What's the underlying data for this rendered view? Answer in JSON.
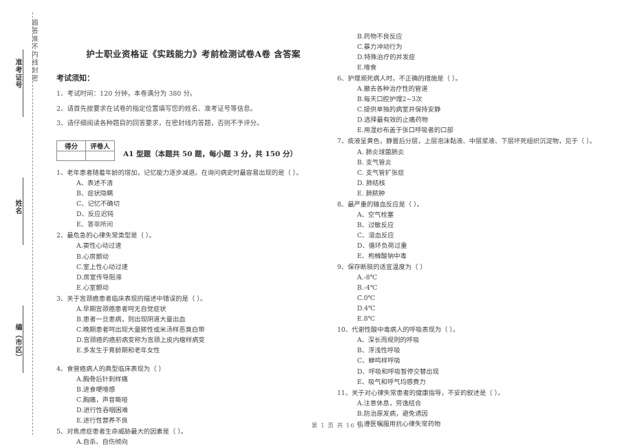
{
  "seal": {
    "dashed_text": "题答准不内线封密",
    "labels": [
      {
        "text": "准考证号"
      },
      {
        "text": "姓名"
      },
      {
        "text": "编（市区）"
      }
    ]
  },
  "document": {
    "title": "护士职业资格证《实践能力》考前检测试卷A卷 含答案",
    "notice_heading": "考试须知：",
    "notices": [
      "1、考试时间：120 分钟，本卷满分为 380 分。",
      "2、请首先按要求在试卷的指定位置填写您的姓名、准考证号等信息。",
      "3、请仔细阅读各种题目的回答要求，在密封线内答题，否则不予评分。"
    ],
    "score_table": {
      "header_score": "得分",
      "header_grader": "评卷人",
      "value_score": "",
      "value_grader": ""
    },
    "section_title": "A1 型题（本题共 50 题，每小题 3 分，共 150 分）",
    "footer": "第 1 页 共 16 页"
  },
  "left_column": {
    "questions": [
      {
        "stem": "1、老年患者随着年龄的增加，记忆能力逐步减退。在询问病史时最容易出现的是（    ）。",
        "options": [
          "A、表述不清",
          "B、症状隐瞒",
          "C、记忆不确切",
          "D、反应迟钝",
          "E、答非所问"
        ]
      },
      {
        "stem": "2、最危急的心律失常类型是（    ）。",
        "options": [
          "A.窦性心动过速",
          "B.心房颤动",
          "C.室上性心动过速",
          "D.房室传导阻滞",
          "E.心室颤动"
        ]
      },
      {
        "stem": "3、关于宫颈癌患者临床表现的描述中错误的是（    ）。",
        "options": [
          "A.早期宫颈癌患者呵无自觉症状",
          "B.患者一旦患病，则出现阴道大量出血",
          "C.晚期患者呵出现大量脓性或米汤样恶臭白带",
          "D.宫颈癌的癌前病变称为宫颈上皮内瘤样病变",
          "E.多发生于育龄期和老年女性"
        ]
      },
      {
        "stem": "4、食管癌病人的典型临床表现为（    ）",
        "options": [
          "A.胸骨后针刺样痛",
          "B.进食哽噎感",
          "C.胸痛，声音嘶哑",
          "D.进行性吞咽困难",
          "E.进行性营养不良"
        ]
      },
      {
        "stem": "5、对焦虑症患者生命威胁最大的因素是（    ）。",
        "options": [
          "A.自杀、自伤倾向"
        ]
      }
    ]
  },
  "right_column": {
    "questions": [
      {
        "stem": "",
        "options": [
          "B.药物不良反应",
          "C.暴力冲动行为",
          "D.特殊治疗的并发症",
          "E.噎食"
        ]
      },
      {
        "stem": "6、护理濒死病人时，不正确的措施是（    ）。",
        "options": [
          "A.撤去各种治疗性的管道",
          "B.每天口腔护理2~3次",
          "C.提供单独的病室并保持安静",
          "D.选择最有效的止痛药物",
          "E.用湿纱布盖于张口呼吸者的口部"
        ]
      },
      {
        "stem": "7、痰液呈黄色，静置后分层，上层泡沫黏液、中层浆液、下层坏死组织沉淀物，见于（    ）。",
        "options": [
          "A. 肺炎球菌肺炎",
          "B. 支气管炎",
          "C. 支气管扩张症",
          "D. 肺结核",
          "E. 肺脓肿"
        ]
      },
      {
        "stem": "8、最严重的输血反应是（    ）。",
        "options": [
          "A、空气栓塞",
          "B、过敏反应",
          "C、溶血反应",
          "D、循环负荷过重",
          "E、枸橼酸钠中毒"
        ]
      },
      {
        "stem": "9、保存断肢的适宜温度为（    ）",
        "options": [
          "A.-8℃",
          "B.-4℃",
          "C.0℃",
          "D.4℃",
          "E.8℃"
        ]
      },
      {
        "stem": "10、代谢性酸中毒病人的呼吸表现为（    ）。",
        "options": [
          "A、深长而规则的呼吸",
          "B、浮浅性呼吸",
          "C、蝉鸣样呼吸",
          "D、呼吸和呼吸暂停交替出现",
          "E、吸气和呼气均感费力"
        ]
      },
      {
        "stem": "11、关于对心律失常患者的健康指导，不妥的叙述是（    ）。",
        "options": [
          "A.注意休息，劳逸结合",
          "B.防治原发病，避免诱因",
          "C.遵医嘱服用抗心律失常药物"
        ]
      }
    ]
  }
}
